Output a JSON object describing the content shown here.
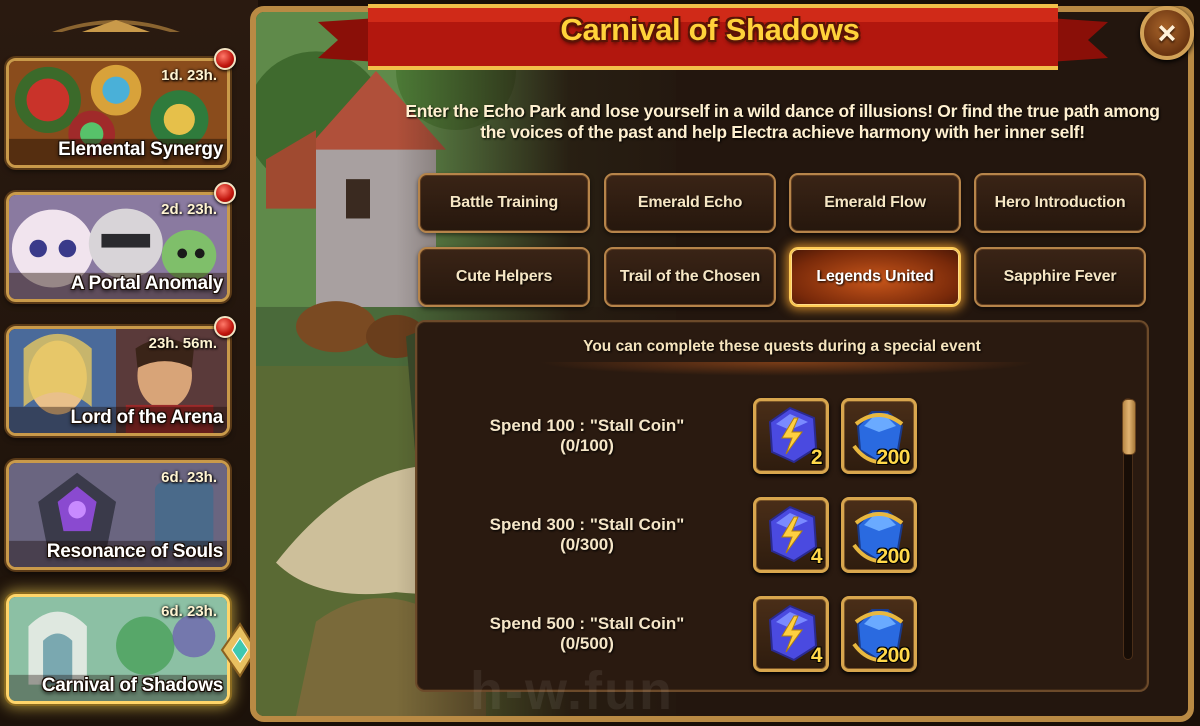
{
  "sidebar": {
    "events": [
      {
        "name": "Elemental Synergy",
        "timer": "1d. 23h.",
        "notification": true,
        "active": false
      },
      {
        "name": "A Portal Anomaly",
        "timer": "2d. 23h.",
        "notification": true,
        "active": false
      },
      {
        "name": "Lord of the Arena",
        "timer": "23h. 56m.",
        "notification": true,
        "active": false
      },
      {
        "name": "Resonance of Souls",
        "timer": "6d. 23h.",
        "notification": false,
        "active": false
      },
      {
        "name": "Carnival of Shadows",
        "timer": "6d. 23h.",
        "notification": false,
        "active": true
      }
    ]
  },
  "panel": {
    "title": "Carnival of Shadows",
    "close_icon": "×",
    "description": "Enter the Echo Park and lose yourself in a wild dance of illusions! Or find the true path among the voices of the past and help Electra achieve harmony with her inner self!"
  },
  "tabs": [
    {
      "label": "Battle Training",
      "selected": false
    },
    {
      "label": "Emerald Echo",
      "selected": false
    },
    {
      "label": "Emerald Flow",
      "selected": false
    },
    {
      "label": "Hero Introduction",
      "selected": false
    },
    {
      "label": "Cute Helpers",
      "selected": false
    },
    {
      "label": "Trail of the Chosen",
      "selected": false
    },
    {
      "label": "Legends United",
      "selected": true
    },
    {
      "label": "Sapphire Fever",
      "selected": false
    }
  ],
  "quests": {
    "header": "You can complete these quests during a special event",
    "items": [
      {
        "title": "Spend 100 : \"Stall Coin\"",
        "progress": "(0/100)",
        "rewards": [
          {
            "icon": "lightning-crystal-icon",
            "qty": "2"
          },
          {
            "icon": "sapphire-gem-icon",
            "qty": "200"
          }
        ]
      },
      {
        "title": "Spend 300 : \"Stall Coin\"",
        "progress": "(0/300)",
        "rewards": [
          {
            "icon": "lightning-crystal-icon",
            "qty": "4"
          },
          {
            "icon": "sapphire-gem-icon",
            "qty": "200"
          }
        ]
      },
      {
        "title": "Spend 500 : \"Stall Coin\"",
        "progress": "(0/500)",
        "rewards": [
          {
            "icon": "lightning-crystal-icon",
            "qty": "4"
          },
          {
            "icon": "sapphire-gem-icon",
            "qty": "200"
          }
        ]
      }
    ]
  },
  "watermark": "h-w.fun",
  "colors": {
    "frame_gold": "#b98a44",
    "title_yellow": "#ffd23a",
    "ribbon_red": "#b2170e",
    "selected_tab_orange": "#c8561a",
    "notification_red": "#c0150d"
  }
}
